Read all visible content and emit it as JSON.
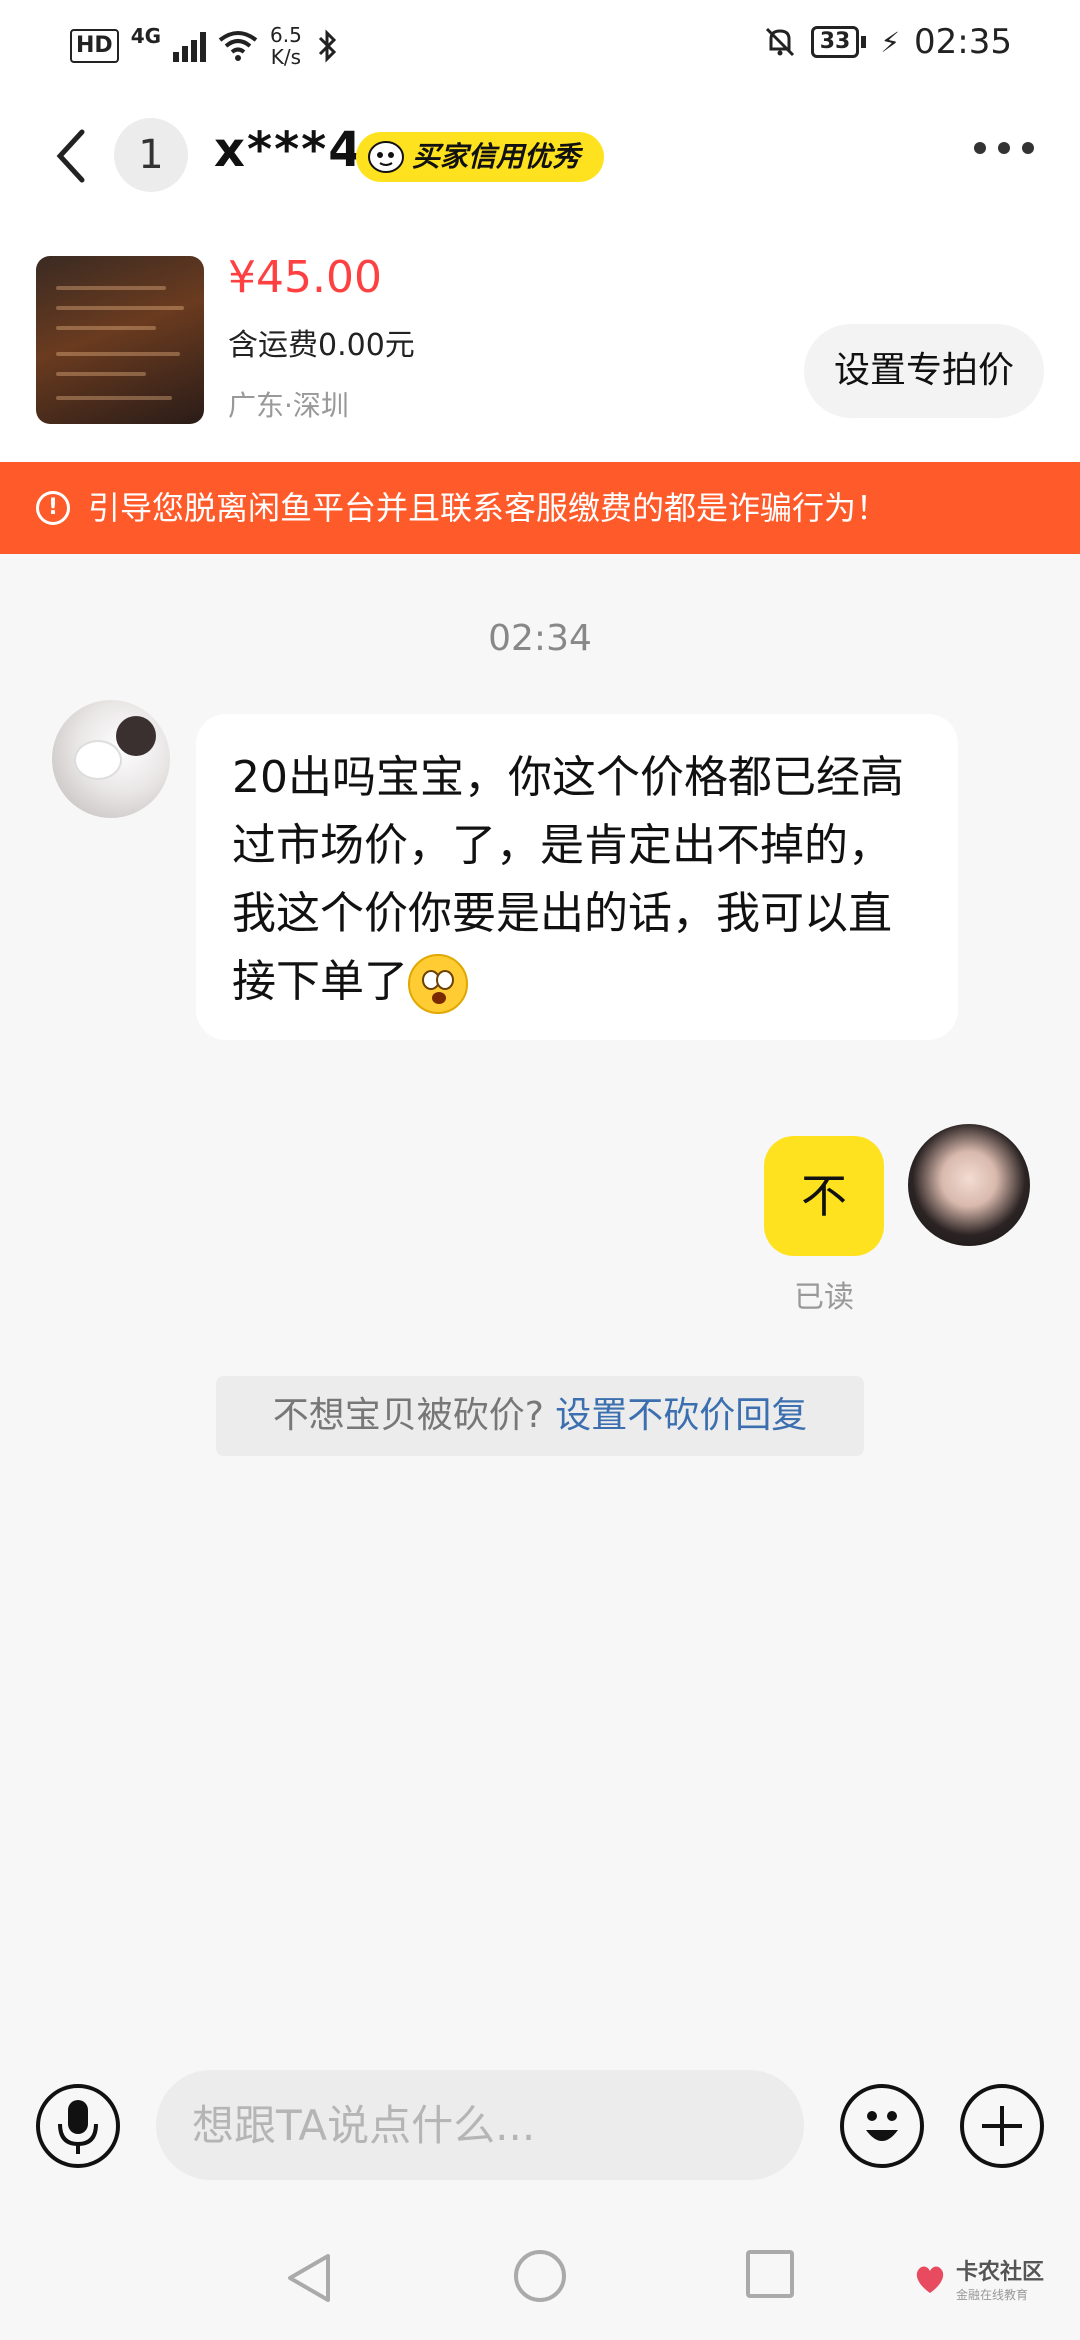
{
  "status_bar": {
    "hd": "HD",
    "network": "4G",
    "speed_value": "6.5",
    "speed_unit": "K/s",
    "battery": "33",
    "time": "02:35"
  },
  "header": {
    "unread_count": "1",
    "username": "x***4",
    "credit_badge": "买家信用优秀"
  },
  "product": {
    "price": "¥45.00",
    "shipping": "含运费0.00元",
    "location": "广东·深圳",
    "special_price_button": "设置专拍价"
  },
  "warning": {
    "text": "引导您脱离闲鱼平台并且联系客服缴费的都是诈骗行为！"
  },
  "chat": {
    "timestamp": "02:34",
    "messages": [
      {
        "side": "left",
        "text": "20出吗宝宝，你这个价格都已经高过市场价，了，是肯定出不掉的，我这个价你要是出的话，我可以直接下单了"
      },
      {
        "side": "right",
        "text": "不",
        "status": "已读"
      }
    ],
    "tip_prefix": "不想宝贝被砍价?",
    "tip_link": "设置不砍价回复"
  },
  "input": {
    "placeholder": "想跟TA说点什么..."
  },
  "watermark": {
    "main": "卡农社区",
    "sub": "金融在线教育"
  },
  "colors": {
    "accent_yellow": "#ffe21f",
    "price_red": "#ff4040",
    "warning_orange": "#ff5a2a",
    "link_blue": "#3b6fb0"
  }
}
